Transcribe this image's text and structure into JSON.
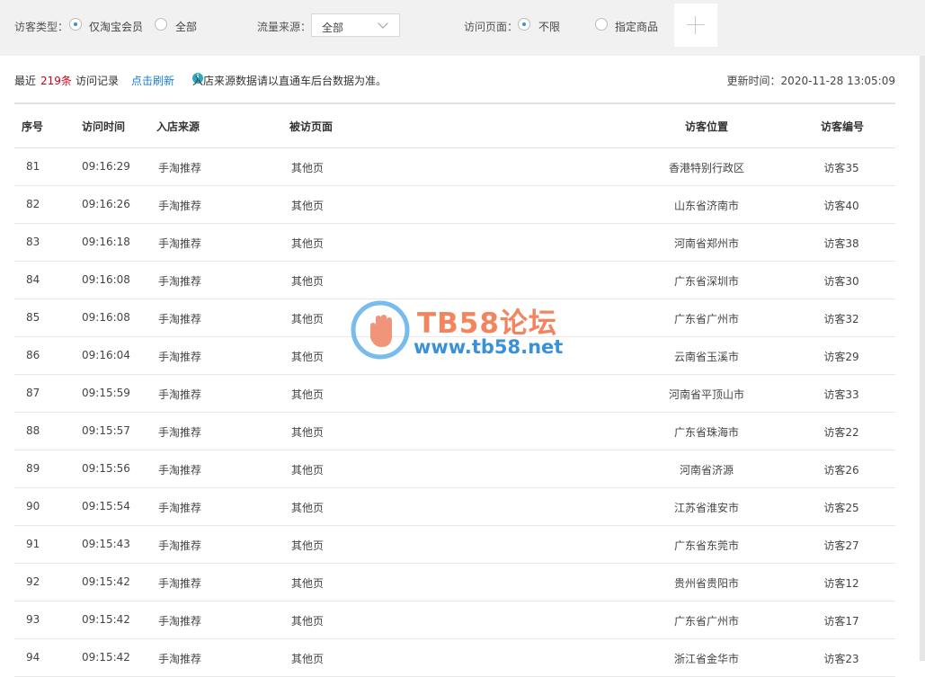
{
  "filters": {
    "visitor_type_label": "访客类型：",
    "visitor_type_options": [
      {
        "label": "仅淘宝会员",
        "checked": true
      },
      {
        "label": "全部",
        "checked": false
      }
    ],
    "traffic_source_label": "流量来源：",
    "traffic_source_value": "全部",
    "visit_page_label": "访问页面：",
    "visit_page_options": [
      {
        "label": "不限",
        "checked": true
      },
      {
        "label": "指定商品",
        "checked": false
      }
    ]
  },
  "summary": {
    "recent_prefix": "最近",
    "count": "219条",
    "records_label": "访问记录",
    "refresh_label": "点击刷新",
    "info_icon": "i",
    "notice": "入店来源数据请以直通车后台数据为准。",
    "update_time": "更新时间：2020-11-28 13:05:09"
  },
  "table": {
    "headers": [
      "序号",
      "访问时间",
      "入店来源",
      "被访页面",
      "访客位置",
      "访客编号"
    ],
    "rows": [
      [
        "81",
        "09:16:29",
        "手淘推荐",
        "其他页",
        "香港特别行政区",
        "访客35"
      ],
      [
        "82",
        "09:16:26",
        "手淘推荐",
        "其他页",
        "山东省济南市",
        "访客40"
      ],
      [
        "83",
        "09:16:18",
        "手淘推荐",
        "其他页",
        "河南省郑州市",
        "访客38"
      ],
      [
        "84",
        "09:16:08",
        "手淘推荐",
        "其他页",
        "广东省深圳市",
        "访客30"
      ],
      [
        "85",
        "09:16:08",
        "手淘推荐",
        "其他页",
        "广东省广州市",
        "访客32"
      ],
      [
        "86",
        "09:16:04",
        "手淘推荐",
        "其他页",
        "云南省玉溪市",
        "访客29"
      ],
      [
        "87",
        "09:15:59",
        "手淘推荐",
        "其他页",
        "河南省平顶山市",
        "访客33"
      ],
      [
        "88",
        "09:15:57",
        "手淘推荐",
        "其他页",
        "广东省珠海市",
        "访客22"
      ],
      [
        "89",
        "09:15:56",
        "手淘推荐",
        "其他页",
        "河南省济源",
        "访客26"
      ],
      [
        "90",
        "09:15:54",
        "手淘推荐",
        "其他页",
        "江苏省淮安市",
        "访客25"
      ],
      [
        "91",
        "09:15:43",
        "手淘推荐",
        "其他页",
        "广东省东莞市",
        "访客27"
      ],
      [
        "92",
        "09:15:42",
        "手淘推荐",
        "其他页",
        "贵州省贵阳市",
        "访客12"
      ],
      [
        "93",
        "09:15:42",
        "手淘推荐",
        "其他页",
        "广东省广州市",
        "访客17"
      ],
      [
        "94",
        "09:15:42",
        "手淘推荐",
        "其他页",
        "浙江省金华市",
        "访客23"
      ]
    ]
  },
  "watermark": {
    "title": "TB58论坛",
    "url": "www.tb58.net"
  },
  "colors": {
    "accent": "#3b8fe0",
    "count_red": "#d0021b",
    "link_blue": "#1a7fd4",
    "filter_bg": "#f1f1f1"
  }
}
